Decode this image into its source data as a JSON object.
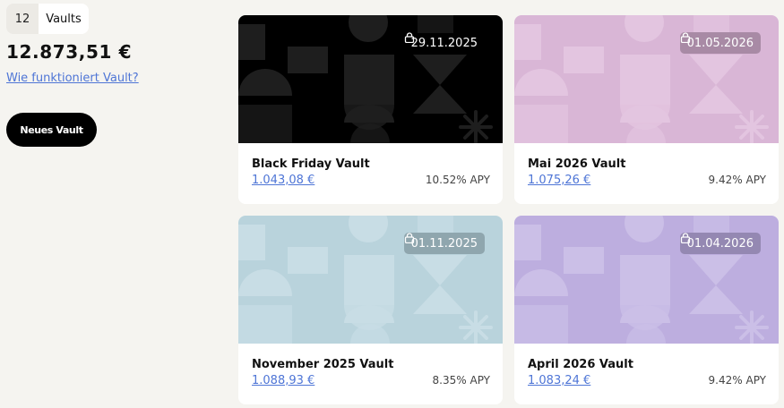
{
  "summary": {
    "count": "12",
    "count_label": "Vaults",
    "total": "12.873,51 €",
    "help_link": "Wie funktioniert Vault?",
    "new_button": "Neues Vault"
  },
  "vaults": [
    {
      "title": "Black Friday Vault",
      "date": "29.11.2025",
      "amount": "1.043,08 €",
      "apy": "10.52% APY",
      "bg": "#000000",
      "shape": "#1e1e1e",
      "badge_bg": "#000000"
    },
    {
      "title": "Mai 2026 Vault",
      "date": "01.05.2026",
      "amount": "1.075,26 €",
      "apy": "9.42% APY",
      "bg": "#d9b6d6",
      "shape": "#e3c5e0",
      "badge_bg": "#a88aa5"
    },
    {
      "title": "November 2025 Vault",
      "date": "01.11.2025",
      "amount": "1.088,93 €",
      "apy": "8.35% APY",
      "bg": "#b9d3dc",
      "shape": "#c8dde5",
      "badge_bg": "#8fa6ae"
    },
    {
      "title": "April 2026 Vault",
      "date": "01.04.2026",
      "amount": "1.083,24 €",
      "apy": "9.42% APY",
      "bg": "#bdaedf",
      "shape": "#cbbfe7",
      "badge_bg": "#9488b2"
    }
  ]
}
